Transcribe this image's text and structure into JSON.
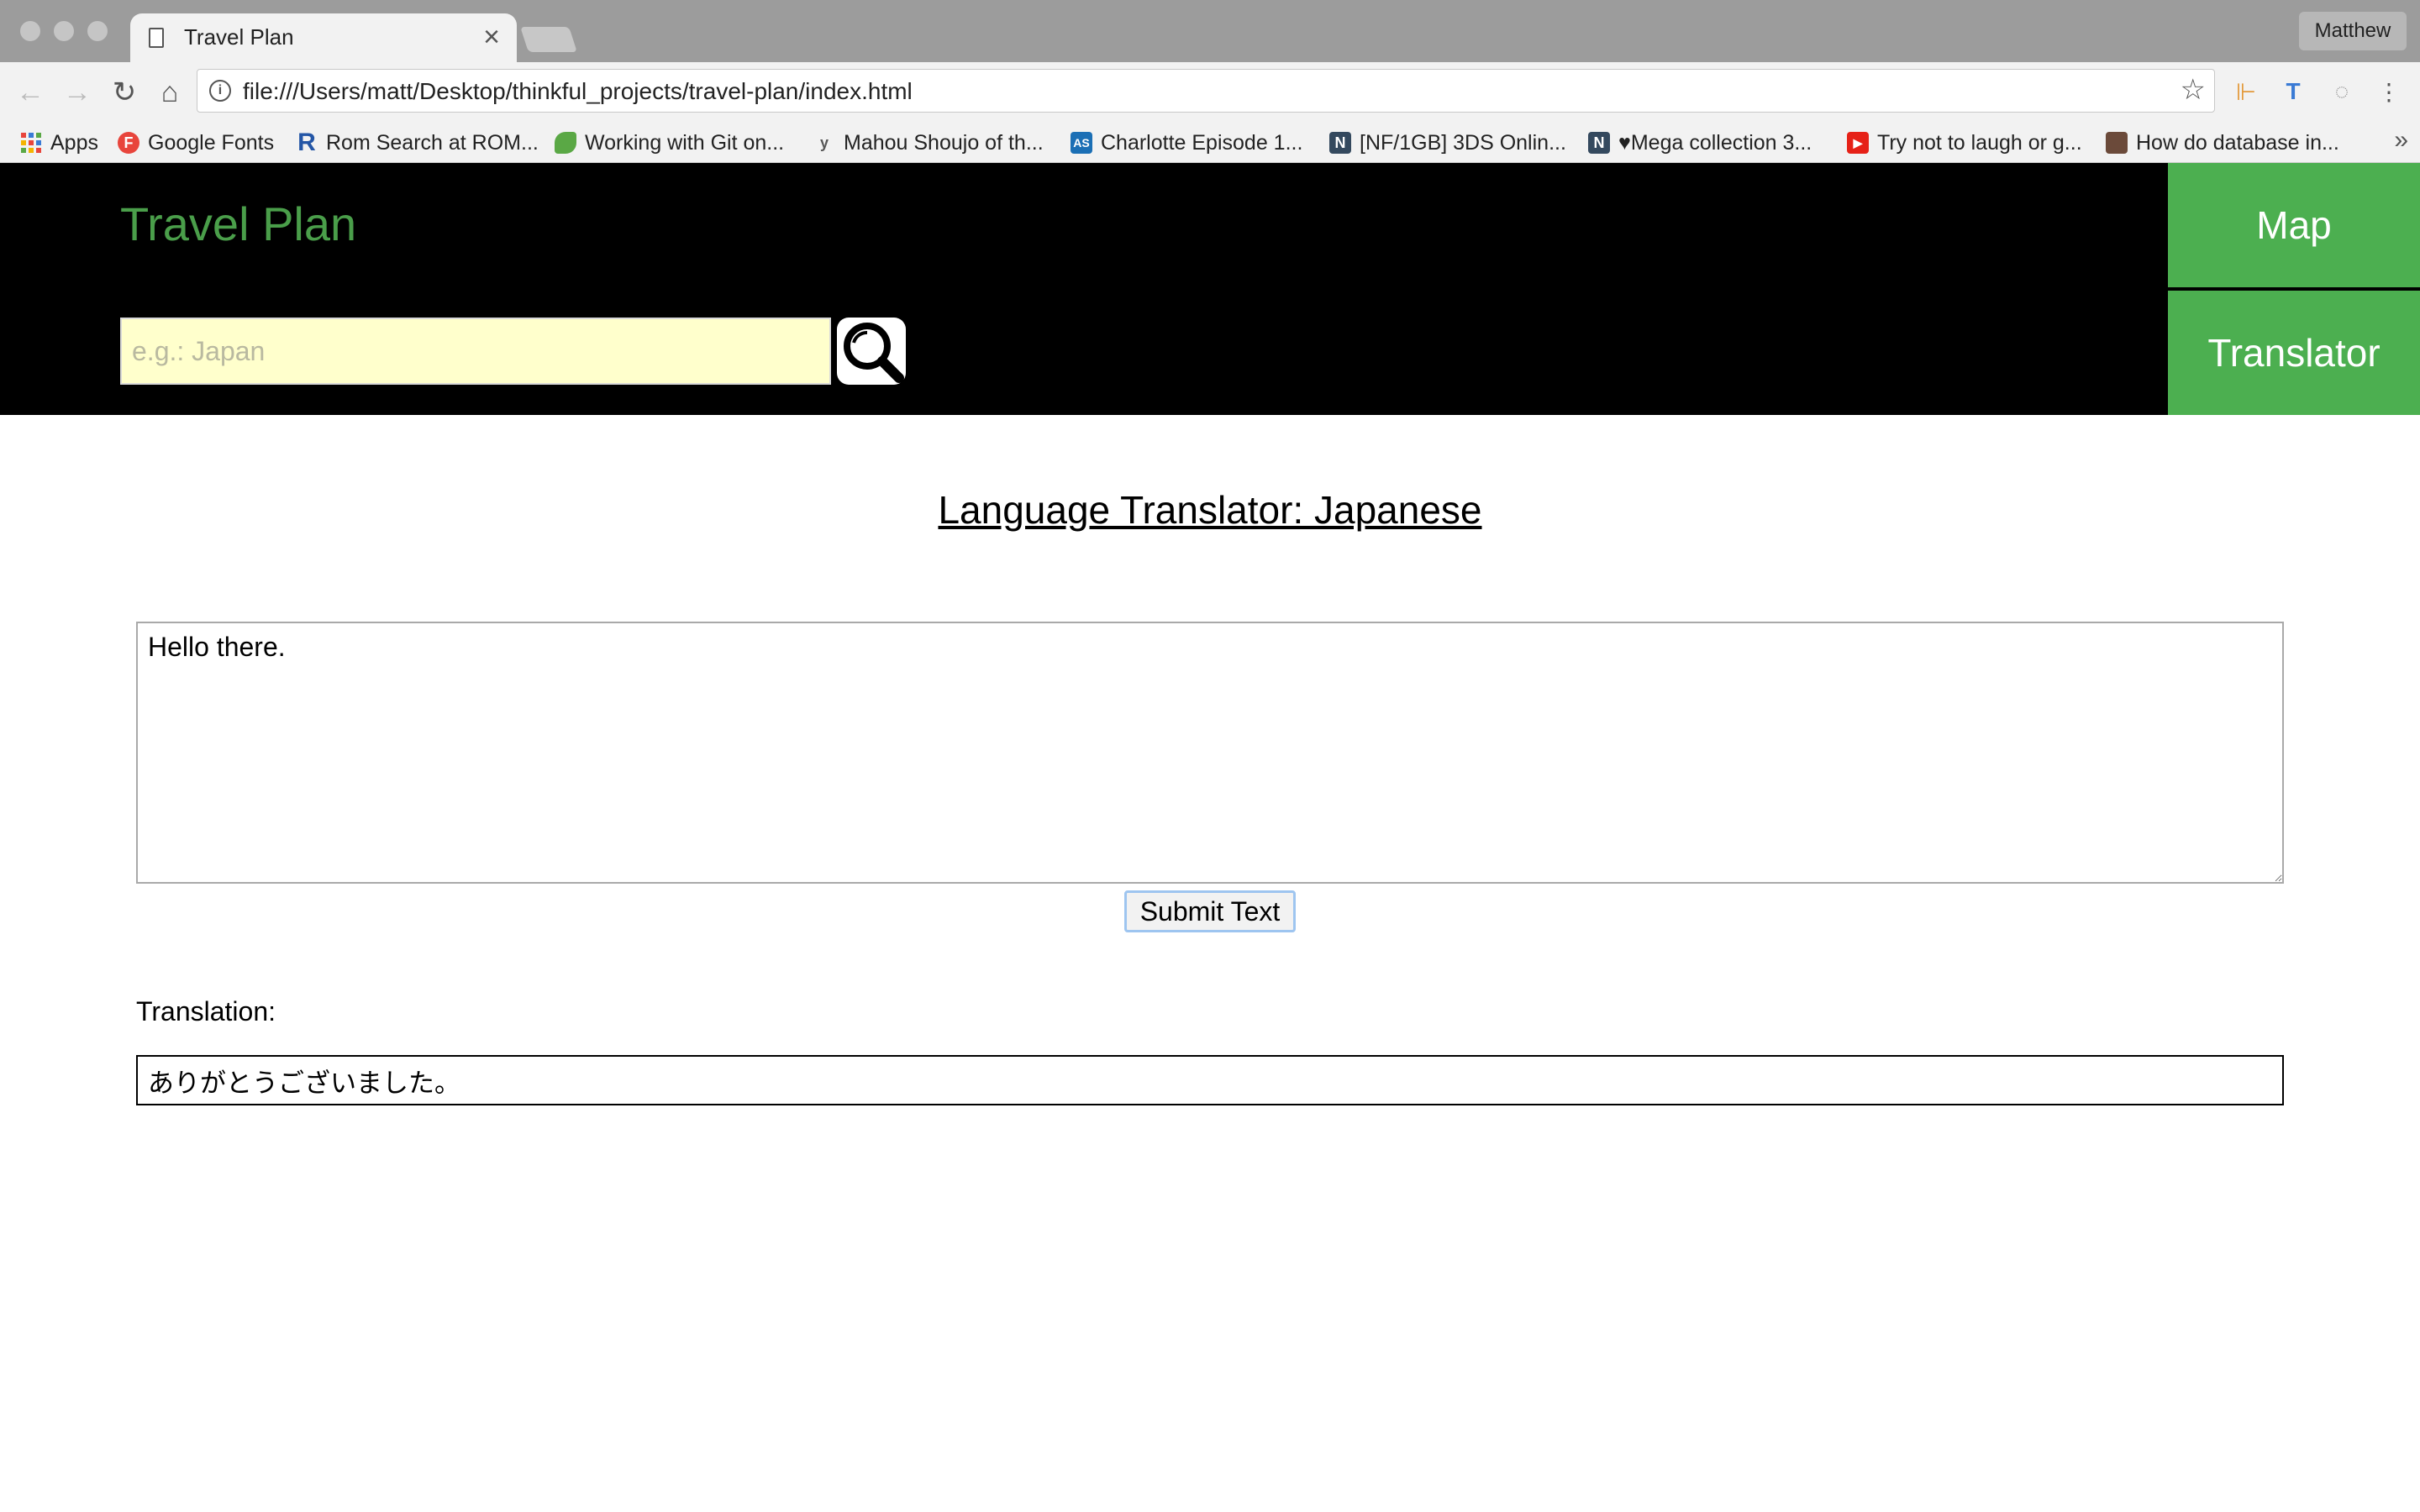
{
  "browser": {
    "tab_title": "Travel Plan",
    "tab_close": "×",
    "profile_name": "Matthew",
    "url": "file:///Users/matt/Desktop/thinkful_projects/travel-plan/index.html",
    "icons": {
      "back": "arrow-left-icon",
      "forward": "arrow-right-icon",
      "reload": "reload-icon",
      "home": "home-icon",
      "info": "info-icon",
      "star": "star-icon",
      "menu": "kebab-menu-icon"
    },
    "bookmarks": [
      {
        "label": "Apps",
        "icon": "apps-grid-icon"
      },
      {
        "label": "Google Fonts",
        "icon": "F",
        "color": "#e8453c"
      },
      {
        "label": "Rom Search at ROM...",
        "icon": "R",
        "color": "#2456a6"
      },
      {
        "label": "Working with Git on...",
        "icon": "leaf",
        "color": "#5aa845"
      },
      {
        "label": "Mahou Shoujo of th...",
        "icon": "y",
        "color": "#555555"
      },
      {
        "label": "Charlotte Episode 1...",
        "icon": "AS",
        "color": "#1b6fb5"
      },
      {
        "label": "[NF/1GB] 3DS Onlin...",
        "icon": "N",
        "color": "#34495e"
      },
      {
        "label": "♥Mega collection 3...",
        "icon": "N",
        "color": "#34495e"
      },
      {
        "label": "Try not to laugh or g...",
        "icon": "▶",
        "color": "#e62117"
      },
      {
        "label": "How do database in...",
        "icon": "img",
        "color": "#6b4a3a"
      }
    ],
    "bookmarks_more": "»"
  },
  "site": {
    "title": "Travel Plan",
    "search_placeholder": "e.g.: Japan",
    "search_value": "",
    "nav": {
      "map_label": "Map",
      "translator_label": "Translator"
    },
    "colors": {
      "accent_green": "#4caf50",
      "title_green": "#4a9e4a",
      "header_bg": "#000000",
      "search_bg": "#ffffcc"
    }
  },
  "translator": {
    "heading": "Language Translator: Japanese",
    "input_text": "Hello there.",
    "submit_label": "Submit Text",
    "translation_label": "Translation:",
    "translation_output": "ありがとうございました。"
  }
}
